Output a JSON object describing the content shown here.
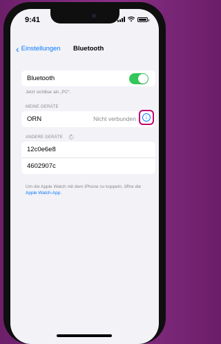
{
  "status_bar": {
    "time": "9:41"
  },
  "nav": {
    "back_label": "Einstellungen",
    "title": "Bluetooth"
  },
  "bluetooth": {
    "label": "Bluetooth",
    "enabled": true,
    "visible_caption": "Jetzt sichtbar als „PC“."
  },
  "my_devices": {
    "header": "MEINE GERÄTE",
    "items": [
      {
        "name": "ORN",
        "status": "Nicht verbunden"
      }
    ]
  },
  "other_devices": {
    "header": "ANDERE GERÄTE",
    "items": [
      {
        "name": "12c0e6e8"
      },
      {
        "name": "4602907c"
      }
    ]
  },
  "footer": {
    "text": "Um die Apple Watch mit dem iPhone zu koppeln, öffne die",
    "link": "Apple Watch-App",
    "end": "."
  },
  "colors": {
    "accent": "#0a7aff",
    "toggle_on": "#34c759",
    "highlight": "#c4006d",
    "background": "#8a3087"
  }
}
